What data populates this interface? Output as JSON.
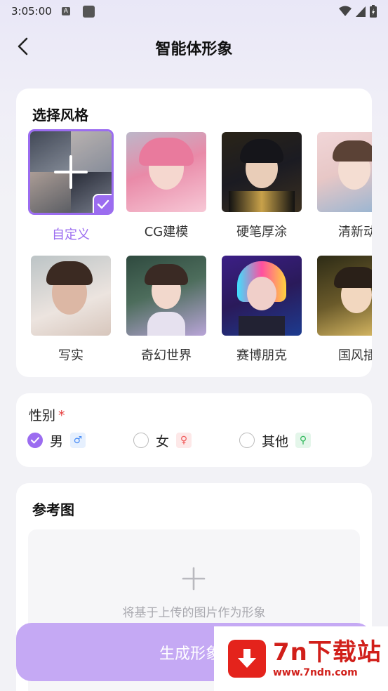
{
  "status_bar": {
    "time": "3:05:00",
    "a_badge": "A"
  },
  "header": {
    "title": "智能体形象",
    "back_icon": "chevron-left-icon"
  },
  "style_section": {
    "title": "选择风格",
    "selected": "自定义",
    "items": [
      {
        "label": "自定义",
        "selected": true,
        "colors": [
          "#6a6f7a",
          "#b9bcc4"
        ]
      },
      {
        "label": "CG建模",
        "selected": false,
        "colors": [
          "#e98aa8",
          "#f5c7d4"
        ]
      },
      {
        "label": "硬笔厚涂",
        "selected": false,
        "colors": [
          "#1b1b22",
          "#c9a24a"
        ]
      },
      {
        "label": "清新动",
        "selected": false,
        "colors": [
          "#e7c7c6",
          "#7aa6c9"
        ]
      },
      {
        "label": "写实",
        "selected": false,
        "colors": [
          "#c8a798",
          "#ece4df"
        ]
      },
      {
        "label": "奇幻世界",
        "selected": false,
        "colors": [
          "#3a5a4a",
          "#b9a5d8"
        ]
      },
      {
        "label": "赛博朋克",
        "selected": false,
        "colors": [
          "#2a1a5a",
          "#ff4fa0"
        ]
      },
      {
        "label": "国风插",
        "selected": false,
        "colors": [
          "#3d3a22",
          "#e6c56b"
        ]
      }
    ]
  },
  "gender": {
    "label": "性别",
    "required_mark": "*",
    "options": [
      {
        "label": "男",
        "checked": true,
        "symbol": "♂",
        "color": "#4a8df5",
        "bg": "#e6f0fe"
      },
      {
        "label": "女",
        "checked": false,
        "symbol": "♀",
        "color": "#f05a5a",
        "bg": "#fde8e8"
      },
      {
        "label": "其他",
        "checked": false,
        "symbol": "⚲",
        "color": "#2fb85a",
        "bg": "#e4f6ea"
      }
    ]
  },
  "reference": {
    "title": "参考图",
    "upload_hint": "将基于上传的图片作为形象"
  },
  "generate_button": {
    "label": "生成形象"
  },
  "watermark": {
    "name": "7n下载站",
    "url": "www.7ndn.com"
  },
  "colors": {
    "accent": "#9b6cf0",
    "button_bg": "#c5a9f4"
  }
}
